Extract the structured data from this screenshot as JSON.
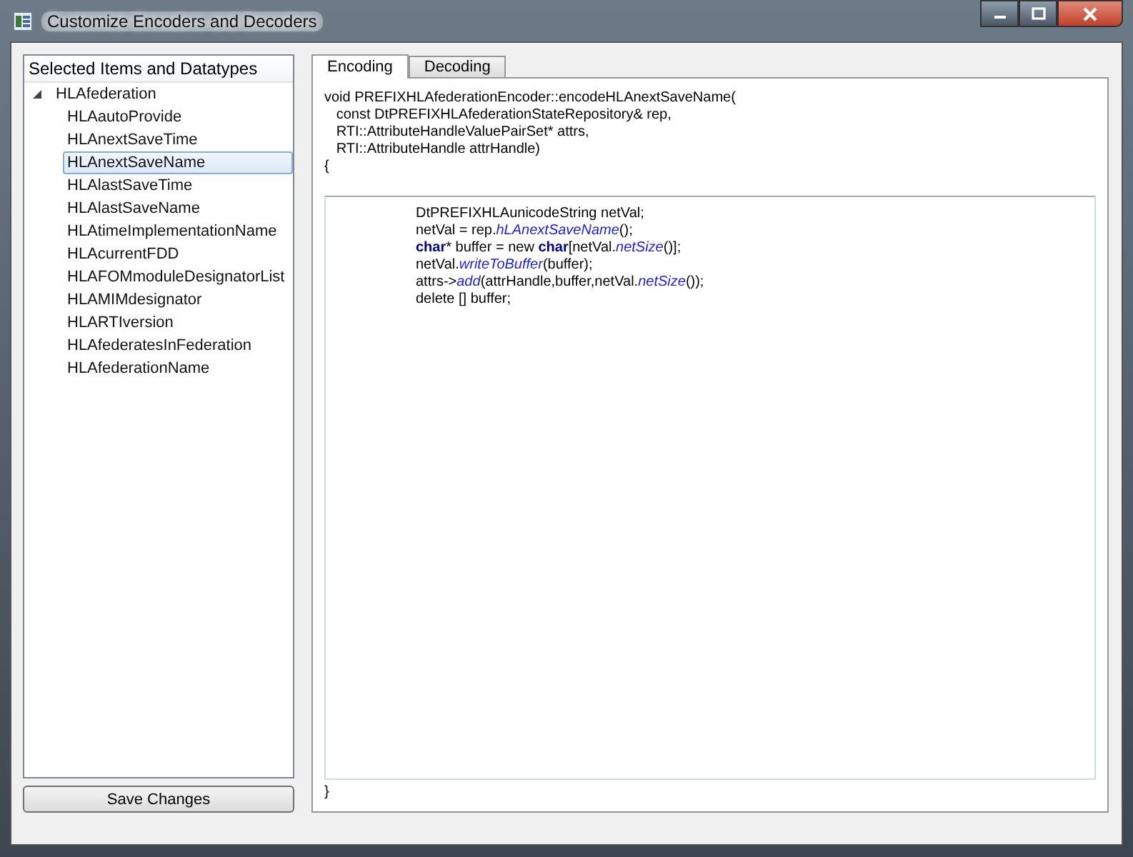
{
  "window": {
    "title": "Customize Encoders and Decoders"
  },
  "tree": {
    "header": "Selected Items and Datatypes",
    "items": [
      {
        "label": "HLAfederation",
        "expanded": true,
        "selected": false,
        "children": [
          {
            "label": "HLAautoProvide",
            "selected": false
          },
          {
            "label": "HLAnextSaveTime",
            "selected": false
          },
          {
            "label": "HLAnextSaveName",
            "selected": true
          },
          {
            "label": "HLAlastSaveTime",
            "selected": false
          },
          {
            "label": "HLAlastSaveName",
            "selected": false
          },
          {
            "label": "HLAtimeImplementationName",
            "selected": false
          },
          {
            "label": "HLAcurrentFDD",
            "selected": false
          },
          {
            "label": "HLAFOMmoduleDesignatorList",
            "selected": false
          },
          {
            "label": "HLAMIMdesignator",
            "selected": false
          },
          {
            "label": "HLARTIversion",
            "selected": false
          },
          {
            "label": "HLAfederatesInFederation",
            "selected": false
          },
          {
            "label": "HLAfederationName",
            "selected": false
          }
        ]
      }
    ]
  },
  "save_button": "Save Changes",
  "tabs": [
    {
      "label": "Encoding",
      "selected": true
    },
    {
      "label": "Decoding",
      "selected": false
    }
  ],
  "header_code": [
    "void PREFIXHLAfederationEncoder::encodeHLAnextSaveName(",
    "   const DtPREFIXHLAfederationStateRepository& rep,",
    "   RTI::AttributeHandleValuePairSet* attrs,",
    "   RTI::AttributeHandle attrHandle)",
    "{"
  ],
  "body_code": [
    [
      {
        "kind": "plain",
        "text": "DtPREFIXHLAunicodeString netVal;"
      }
    ],
    [
      {
        "kind": "plain",
        "text": "netVal = rep."
      },
      {
        "kind": "method",
        "text": "hLAnextSaveName"
      },
      {
        "kind": "plain",
        "text": "();"
      }
    ],
    [
      {
        "kind": "keyword",
        "text": "char"
      },
      {
        "kind": "plain",
        "text": "* buffer = new "
      },
      {
        "kind": "keyword",
        "text": "char"
      },
      {
        "kind": "plain",
        "text": "[netVal."
      },
      {
        "kind": "method",
        "text": "netSize"
      },
      {
        "kind": "plain",
        "text": "()];"
      }
    ],
    [
      {
        "kind": "plain",
        "text": "netVal."
      },
      {
        "kind": "method",
        "text": "writeToBuffer"
      },
      {
        "kind": "plain",
        "text": "(buffer);"
      }
    ],
    [
      {
        "kind": "plain",
        "text": "attrs->"
      },
      {
        "kind": "method",
        "text": "add"
      },
      {
        "kind": "plain",
        "text": "(attrHandle,buffer,netVal."
      },
      {
        "kind": "method",
        "text": "netSize"
      },
      {
        "kind": "plain",
        "text": "());"
      }
    ],
    [
      {
        "kind": "plain",
        "text": "delete [] buffer;"
      }
    ]
  ],
  "footer_code": "}"
}
